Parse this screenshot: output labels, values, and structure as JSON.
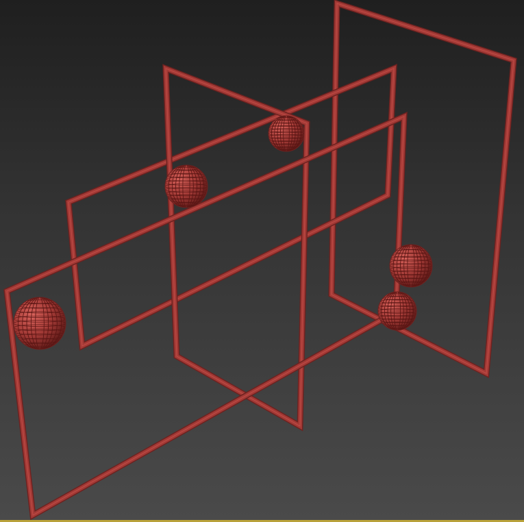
{
  "viewport": {
    "name": "perspective-viewport",
    "background_top": "#1f1f1f",
    "background_bottom": "#4a4a4a",
    "active_border_color": "#b9a23a"
  },
  "scene": {
    "object_color": "#a33a36",
    "object_color_light": "#c9504a",
    "object_color_dark": "#6e2220",
    "wire_color": "#5a1614",
    "frames": [
      {
        "name": "frame-front-left"
      },
      {
        "name": "frame-middle-horizontal"
      },
      {
        "name": "frame-center-vertical"
      },
      {
        "name": "frame-back-horizontal"
      },
      {
        "name": "frame-back-right"
      }
    ],
    "spheres": [
      {
        "name": "sphere-left"
      },
      {
        "name": "sphere-upper-middle"
      },
      {
        "name": "sphere-top-center"
      },
      {
        "name": "sphere-right-upper"
      },
      {
        "name": "sphere-right-lower"
      }
    ]
  }
}
